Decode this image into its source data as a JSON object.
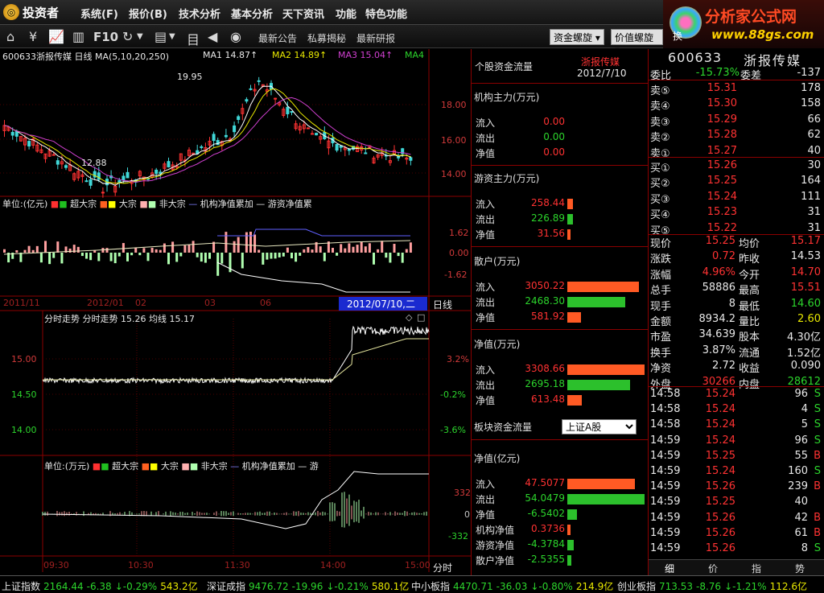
{
  "menubar": {
    "logo": "投资者",
    "items": [
      "系统(F)",
      "报价(B)",
      "技术分析",
      "基本分析",
      "天下资讯",
      "功能",
      "特色功能"
    ]
  },
  "brand": {
    "title": "分析家公式网",
    "url": "www.88gs.com"
  },
  "toolbar": {
    "f10": "F10",
    "links": [
      "最新公告",
      "私募揭秘",
      "最新研报"
    ],
    "btn1": "资金螺旋",
    "btn2": "价值螺旋",
    "btn3": "换"
  },
  "kline": {
    "header": "600633浙报传媒  日线  MA(5,10,20,250)",
    "ma1": "MA1 14.87↑",
    "ma2": "MA2 14.89↑",
    "ma3": "MA3 15.04↑",
    "ma4": "MA4",
    "high_label": "19.95",
    "low_label": "12.88",
    "axis": [
      "18.00",
      "16.00",
      "14.00"
    ]
  },
  "flow_panel": {
    "header": "单位:(亿元)",
    "legend": [
      "超大宗",
      "大宗",
      "非大宗",
      "机构净值累加",
      "游资净值累"
    ],
    "axis": [
      "1.62",
      "0.00",
      "-1.62"
    ]
  },
  "dates": {
    "labels": [
      "2011/11",
      "2012/01",
      "02",
      "03",
      "06"
    ],
    "cursor_date": "2012/07/10,二",
    "period": "日线"
  },
  "intraday": {
    "header": "分时走势  分时走势  15.26  均线  15.17",
    "axis_left": [
      "15.00",
      "14.50",
      "14.00"
    ],
    "axis_right": [
      "3.2%",
      "-0.2%",
      "-3.6%"
    ]
  },
  "intraday_flow": {
    "header": "单位:(万元)",
    "legend": [
      "超大宗",
      "大宗",
      "非大宗",
      "机构净值累加",
      "游"
    ],
    "axis": [
      "332",
      "0",
      "-332"
    ]
  },
  "time_axis": [
    "09:30",
    "10:30",
    "11:30",
    "14:00",
    "15:00"
  ],
  "time_label": "分时",
  "fund_flow": {
    "title": "个股资金流量",
    "stock": "浙报传媒",
    "date": "2012/7/10",
    "sections": [
      {
        "title": "机构主力(万元)",
        "rows": [
          [
            "流入",
            "0.00"
          ],
          [
            "流出",
            "0.00"
          ],
          [
            "净值",
            "0.00"
          ]
        ]
      },
      {
        "title": "游资主力(万元)",
        "rows": [
          [
            "流入",
            "258.44"
          ],
          [
            "流出",
            "226.89"
          ],
          [
            "净值",
            "31.56"
          ]
        ]
      },
      {
        "title": "散户(万元)",
        "rows": [
          [
            "流入",
            "3050.22"
          ],
          [
            "流出",
            "2468.30"
          ],
          [
            "净值",
            "581.92"
          ]
        ]
      },
      {
        "title": "净值(万元)",
        "rows": [
          [
            "流入",
            "3308.66"
          ],
          [
            "流出",
            "2695.18"
          ],
          [
            "净值",
            "613.48"
          ]
        ]
      }
    ],
    "sector_title": "板块资金流量",
    "sector_select": "上证A股",
    "sector_sub": "净值(亿元)",
    "sector_rows": [
      [
        "流入",
        "47.5077"
      ],
      [
        "流出",
        "54.0479"
      ],
      [
        "净值",
        "-6.5402"
      ],
      [
        "机构净值",
        "0.3736"
      ],
      [
        "游资净值",
        "-4.3784"
      ],
      [
        "散户净值",
        "-2.5355"
      ]
    ]
  },
  "quote": {
    "code": "600633",
    "name": "浙报传媒",
    "weibi_label": "委比",
    "weibi": "-15.73%",
    "weicha_label": "委差",
    "weicha": "-137",
    "asks": [
      [
        "卖⑤",
        "15.31",
        "178"
      ],
      [
        "卖④",
        "15.30",
        "158"
      ],
      [
        "卖③",
        "15.29",
        "66"
      ],
      [
        "卖②",
        "15.28",
        "62"
      ],
      [
        "卖①",
        "15.27",
        "40"
      ]
    ],
    "bids": [
      [
        "买①",
        "15.26",
        "30"
      ],
      [
        "买②",
        "15.25",
        "164"
      ],
      [
        "买③",
        "15.24",
        "111"
      ],
      [
        "买④",
        "15.23",
        "31"
      ],
      [
        "买⑤",
        "15.22",
        "31"
      ]
    ],
    "stats": [
      [
        "现价",
        "15.25",
        "均价",
        "15.17"
      ],
      [
        "涨跌",
        "0.72",
        "昨收",
        "14.53"
      ],
      [
        "涨幅",
        "4.96%",
        "今开",
        "14.70"
      ],
      [
        "总手",
        "58886",
        "最高",
        "15.51"
      ],
      [
        "现手",
        "8",
        "最低",
        "14.60"
      ],
      [
        "金额",
        "8934.2",
        "量比",
        "2.60"
      ],
      [
        "市盈",
        "34.639",
        "股本",
        "4.30亿"
      ],
      [
        "换手",
        "3.87%",
        "流通",
        "1.52亿"
      ],
      [
        "净资",
        "2.72",
        "收益",
        "0.090"
      ],
      [
        "外盘",
        "30266",
        "内盘",
        "28612"
      ]
    ],
    "ticks": [
      [
        "14:58",
        "15.24",
        "96",
        "S"
      ],
      [
        "14:58",
        "15.24",
        "4",
        "S"
      ],
      [
        "14:58",
        "15.24",
        "5",
        "S"
      ],
      [
        "14:59",
        "15.24",
        "96",
        "S"
      ],
      [
        "14:59",
        "15.25",
        "55",
        "B"
      ],
      [
        "14:59",
        "15.24",
        "160",
        "S"
      ],
      [
        "14:59",
        "15.26",
        "239",
        "B"
      ],
      [
        "14:59",
        "15.25",
        "40",
        ""
      ],
      [
        "14:59",
        "15.26",
        "42",
        "B"
      ],
      [
        "14:59",
        "15.26",
        "61",
        "B"
      ],
      [
        "14:59",
        "15.26",
        "8",
        "S"
      ]
    ],
    "tabs": [
      "细",
      "价",
      "指",
      "势"
    ]
  },
  "statusbar": [
    {
      "name": "上证指数",
      "value": "2164.44",
      "chg": "-6.38",
      "pct": "↓-0.29%",
      "amt": "543.2亿"
    },
    {
      "name": "深证成指",
      "value": "9476.72",
      "chg": "-19.96",
      "pct": "↓-0.21%",
      "amt": "580.1亿"
    },
    {
      "name": "中小板指",
      "value": "4470.71",
      "chg": "-36.03",
      "pct": "↓-0.80%",
      "amt": "214.9亿"
    },
    {
      "name": "创业板指",
      "value": "713.53",
      "chg": "-8.76",
      "pct": "↓-1.21%",
      "amt": "112.6亿"
    }
  ],
  "colors": {
    "up": "#ff3232",
    "down": "#2cd52c",
    "grid": "#8b0000",
    "yellow": "#e8e800"
  }
}
